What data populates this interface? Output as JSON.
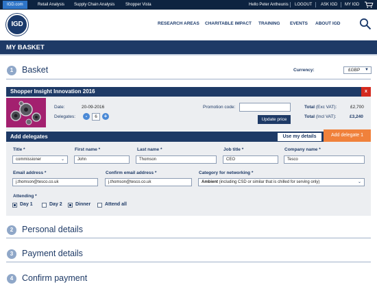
{
  "topbar": {
    "brand": "IGD.com",
    "links": [
      "Retail Analysis",
      "Supply Chain Analysis",
      "Shopper Vista"
    ],
    "user_greeting": "Hello Peter Antheunis",
    "logout": "LOGOUT",
    "ask": "ASK IGD",
    "my_igd": "MY IGD"
  },
  "header": {
    "logo_text": "IGD",
    "nav": [
      "RESEARCH AREAS",
      "CHARITABLE IMPACT",
      "TRAINING",
      "EVENTS",
      "ABOUT IGD"
    ]
  },
  "page": {
    "title": "MY BASKET"
  },
  "steps": [
    {
      "number": "1",
      "label": "Basket"
    },
    {
      "number": "2",
      "label": "Personal details"
    },
    {
      "number": "3",
      "label": "Payment details"
    },
    {
      "number": "4",
      "label": "Confirm payment"
    }
  ],
  "currency": {
    "label": "Currency:",
    "value": "£GBP"
  },
  "product": {
    "title": "Shopper Insight Innovation 2016",
    "close": "x",
    "date_label": "Date:",
    "date_value": "20-09-2016",
    "delegates_label": "Delegates:",
    "delegates_value": "6",
    "minus": "-",
    "plus": "+",
    "promo_label": "Promotion code:",
    "update_label": "Update price",
    "total_exc_label": "Total",
    "total_exc_suffix": "(Exc VAT):",
    "total_exc_value": "£2,700",
    "total_inc_label": "Total",
    "total_inc_suffix": "(Incl VAT):",
    "total_inc_value": "£3,240"
  },
  "delegates": {
    "title": "Add delegates",
    "use_details": "Use my details",
    "add_delegate": "Add delegate 1",
    "fields": {
      "title_label": "Title *",
      "title_value": "commissioner",
      "first_label": "First name *",
      "first_value": "John",
      "last_label": "Last name *",
      "last_value": "Thomson",
      "job_label": "Job title *",
      "job_value": "CEO",
      "company_label": "Company name *",
      "company_value": "Tesco",
      "email_label": "Email address *",
      "email_value": "j.thomson@tesco.co.uk",
      "confirm_label": "Confirm email address *",
      "confirm_value": "j.thomson@tesco.co.uk",
      "category_label": "Category for networking *",
      "category_bold": "Ambient",
      "category_rest": " (including CSD or similar that is chilled for serving only)"
    },
    "attending_label": "Attending *",
    "attending": [
      {
        "label": "Day 1",
        "checked": true
      },
      {
        "label": "Day 2",
        "checked": false
      },
      {
        "label": "Dinner",
        "checked": true
      },
      {
        "label": "Attend all",
        "checked": false
      }
    ]
  },
  "colors": {
    "navy": "#1e3a66",
    "topbar": "#0d2340",
    "accent_orange": "#f0813b",
    "close_red": "#d42a1f",
    "step_circle": "#8fa7c8"
  }
}
